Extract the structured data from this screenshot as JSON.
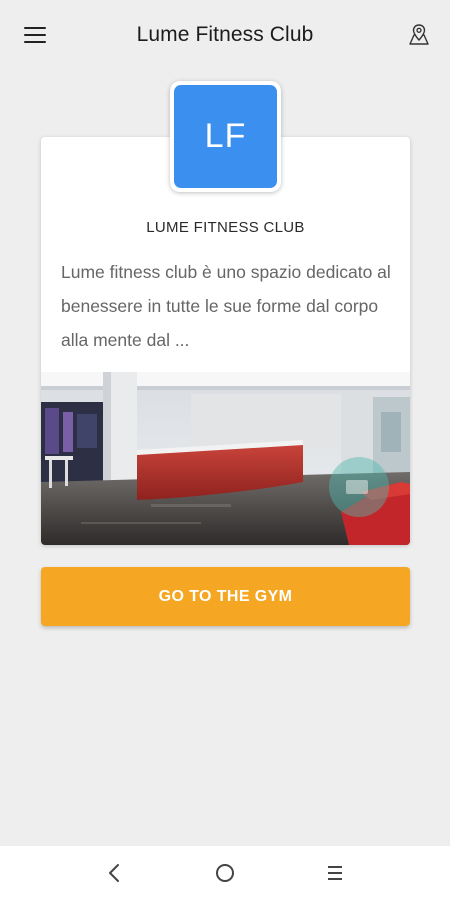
{
  "app_bar": {
    "title": "Lume Fitness Club",
    "menu_icon": "hamburger-menu-icon",
    "right_icon": "map-location-icon"
  },
  "club": {
    "logo_initials": "LF",
    "logo_color": "#3b8fef",
    "name": "LUME FITNESS CLUB",
    "description": "Lume fitness club è uno spazio dedicato al benessere in tutte le sue forme dal corpo alla mente dal ...",
    "photo": "gym-reception-photo"
  },
  "cta": {
    "label": "GO TO THE GYM",
    "color": "#f5a622"
  },
  "system_nav": {
    "back_icon": "back-chevron-icon",
    "home_icon": "home-circle-icon",
    "recents_icon": "recents-lines-icon"
  }
}
